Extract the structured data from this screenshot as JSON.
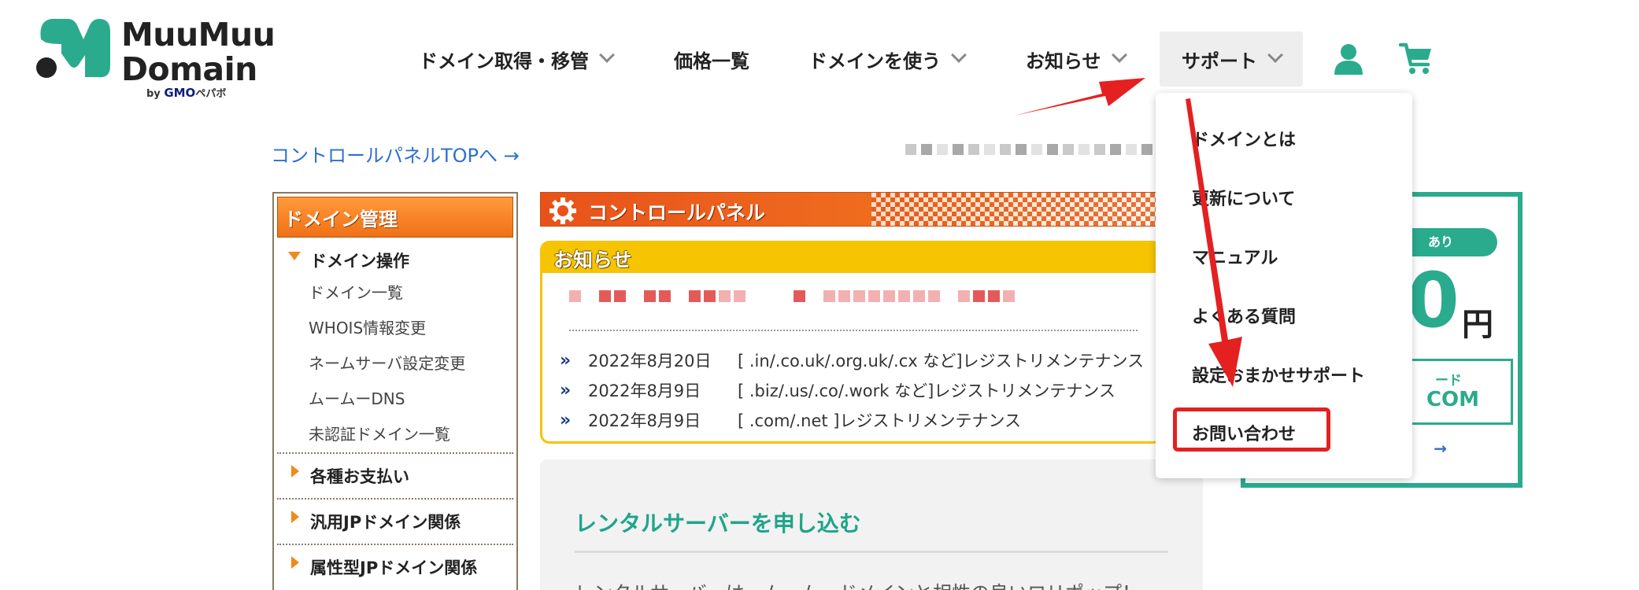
{
  "logo": {
    "line1": "MuuMuu",
    "line2": "Domain",
    "by_prefix": "by",
    "by_brand": "GMO",
    "by_suffix": "ペパボ",
    "brand_color": "#2bab8d"
  },
  "nav": {
    "items": [
      {
        "label": "ドメイン取得・移管",
        "has_chevron": true
      },
      {
        "label": "価格一覧",
        "has_chevron": false
      },
      {
        "label": "ドメインを使う",
        "has_chevron": true
      },
      {
        "label": "お知らせ",
        "has_chevron": true
      },
      {
        "label": "サポート",
        "has_chevron": true,
        "active": true
      }
    ],
    "user_icon": "user-icon",
    "cart_icon": "cart-icon"
  },
  "top_link": "コントロールパネルTOPへ →",
  "sidebar": {
    "heading": "ドメイン管理",
    "group_title": "ドメイン操作",
    "sub_items": [
      "ドメイン一覧",
      "WHOIS情報変更",
      "ネームサーバ設定変更",
      "ムームーDNS",
      "未認証ドメイン一覧"
    ],
    "rows": [
      "各種お支払い",
      "汎用JPドメイン関係",
      "属性型JPドメイン関係"
    ]
  },
  "control_panel": {
    "title": "コントロールパネル"
  },
  "news": {
    "tab_label": "お知らせ",
    "items": [
      {
        "date": "2022年8月20日",
        "text": "[ .in/.co.uk/.org.uk/.cx など]レジストリメンテナンス"
      },
      {
        "date": "2022年8月9日",
        "text": "[ .biz/.us/.co/.work など]レジストリメンテナンス"
      },
      {
        "date": "2022年8月9日",
        "text": "[ .com/.net ]レジストリメンテナンス"
      }
    ]
  },
  "rental": {
    "title": "レンタルサーバーを申し込む",
    "text": "レンタルサーバーは、ムームードメインと相性の良いロリポップ！"
  },
  "promo": {
    "pill_text": "あり",
    "price": "0",
    "yen": "円",
    "code_small": "ード",
    "code_big": "COM",
    "link": "→"
  },
  "dropdown": {
    "items": [
      "ドメインとは",
      "更新について",
      "マニュアル",
      "よくある質問",
      "設定おまかせサポート",
      "お問い合わせ"
    ],
    "highlighted_index": 5,
    "highlight_color": "#e52020"
  },
  "colors": {
    "accent_teal": "#2bab8d",
    "link_blue": "#2d6fd1",
    "orange": "#f07118",
    "yellow": "#f6c400",
    "annotation_red": "#e52020"
  }
}
